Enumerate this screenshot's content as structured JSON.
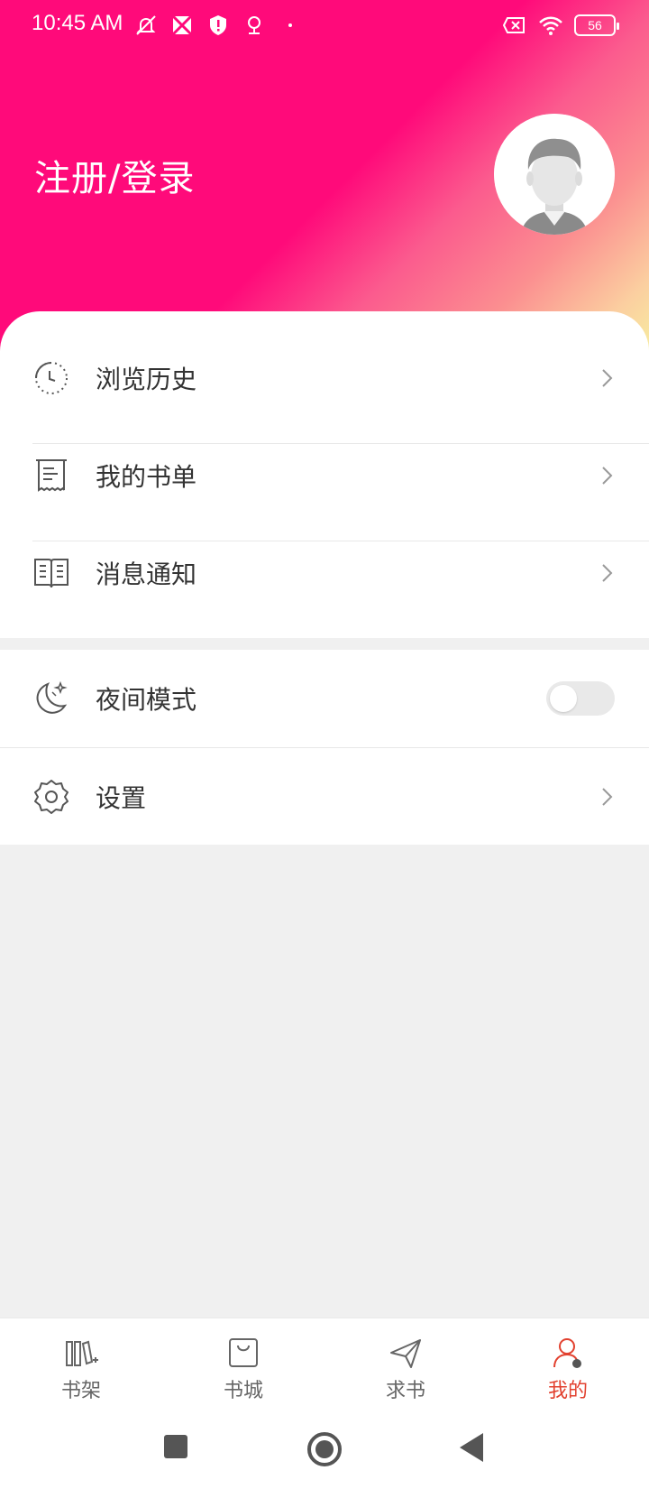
{
  "status_bar": {
    "time": "10:45 AM",
    "battery": "56",
    "icons_left": [
      "muted-bell-icon",
      "photo-icon",
      "shield-icon",
      "pin-icon",
      "dot-icon"
    ],
    "icons_right": [
      "x-mark-box-icon",
      "wifi-icon",
      "battery-icon"
    ]
  },
  "header": {
    "login_text": "注册/登录",
    "avatar_icon": "default-avatar-icon",
    "gradient": [
      "#ff0a7a",
      "#fb8f90",
      "#f7ef9f"
    ]
  },
  "menu": {
    "items": [
      {
        "label": "浏览历史",
        "icon": "clock-icon"
      },
      {
        "label": "我的书单",
        "icon": "receipt-icon"
      },
      {
        "label": "消息通知",
        "icon": "open-book-icon"
      }
    ]
  },
  "settings": {
    "night_mode_label": "夜间模式",
    "night_mode_on": false,
    "settings_label": "设置"
  },
  "tabs": [
    {
      "label": "书架",
      "icon": "bookshelf-icon",
      "active": false
    },
    {
      "label": "书城",
      "icon": "shopping-bag-icon",
      "active": false
    },
    {
      "label": "求书",
      "icon": "paper-plane-icon",
      "active": false
    },
    {
      "label": "我的",
      "icon": "person-icon",
      "active": true
    }
  ],
  "colors": {
    "accent": "#e2412f",
    "header_pink": "#ff0a7a"
  }
}
